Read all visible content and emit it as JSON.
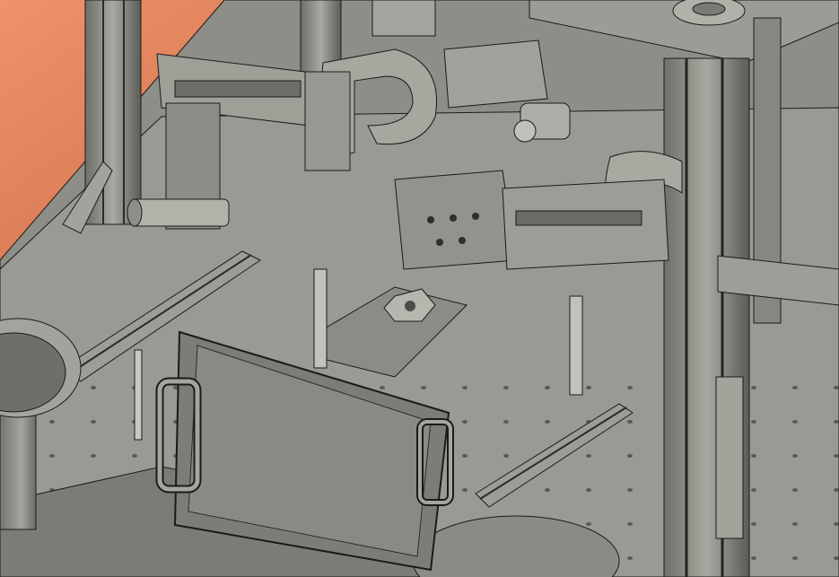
{
  "scene": {
    "subject": "cad-machine-assembly-render",
    "background_top_color": "#e9865e",
    "background_bottom_color": "#3b1d14",
    "metal_color": "#8d8d86",
    "metal_dark_color": "#5f5f59",
    "metal_light_color": "#b4b4ad",
    "edge_color": "#1a1a18"
  }
}
